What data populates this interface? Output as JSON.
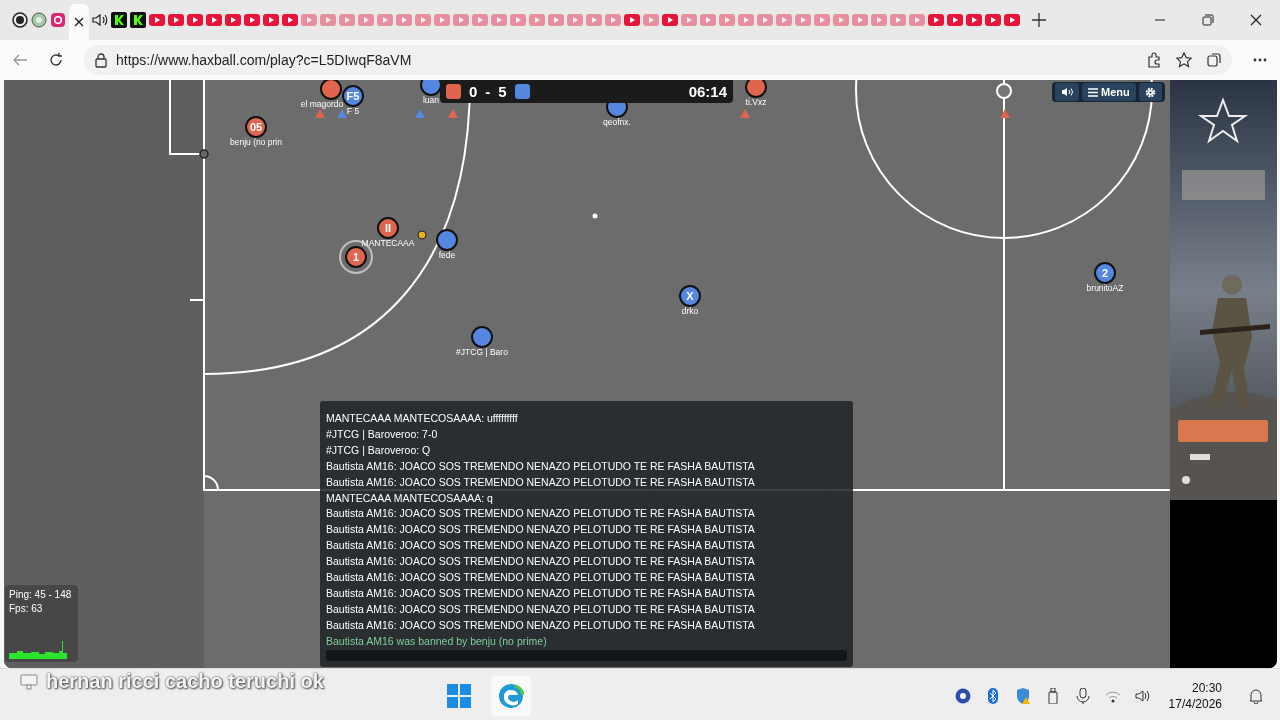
{
  "browser": {
    "tabs": [
      {
        "kind": "record",
        "sleeping": false,
        "selected": false
      },
      {
        "kind": "ball",
        "sleeping": false,
        "selected": false
      },
      {
        "kind": "instagram",
        "sleeping": false,
        "selected": false
      },
      {
        "kind": "close",
        "sleeping": false,
        "selected": true
      },
      {
        "kind": "audio",
        "sleeping": false,
        "selected": false
      },
      {
        "kind": "kick",
        "sleeping": false,
        "selected": false
      },
      {
        "kind": "kick",
        "sleeping": false,
        "selected": false
      },
      {
        "kind": "video",
        "sleeping": false,
        "selected": false
      },
      {
        "kind": "video",
        "sleeping": false,
        "selected": false
      },
      {
        "kind": "video",
        "sleeping": false,
        "selected": false
      },
      {
        "kind": "video",
        "sleeping": false,
        "selected": false
      },
      {
        "kind": "video",
        "sleeping": false,
        "selected": false
      },
      {
        "kind": "video",
        "sleeping": false,
        "selected": false
      },
      {
        "kind": "video",
        "sleeping": false,
        "selected": false
      },
      {
        "kind": "video",
        "sleeping": false,
        "selected": false
      },
      {
        "kind": "video",
        "sleeping": true,
        "selected": false
      },
      {
        "kind": "video",
        "sleeping": true,
        "selected": false
      },
      {
        "kind": "video",
        "sleeping": true,
        "selected": false
      },
      {
        "kind": "video",
        "sleeping": true,
        "selected": false
      },
      {
        "kind": "video",
        "sleeping": true,
        "selected": false
      },
      {
        "kind": "video",
        "sleeping": true,
        "selected": false
      },
      {
        "kind": "video",
        "sleeping": true,
        "selected": false
      },
      {
        "kind": "video",
        "sleeping": true,
        "selected": false
      },
      {
        "kind": "video",
        "sleeping": true,
        "selected": false
      },
      {
        "kind": "video",
        "sleeping": true,
        "selected": false
      },
      {
        "kind": "video",
        "sleeping": true,
        "selected": false
      },
      {
        "kind": "video",
        "sleeping": true,
        "selected": false
      },
      {
        "kind": "video",
        "sleeping": true,
        "selected": false
      },
      {
        "kind": "video",
        "sleeping": true,
        "selected": false
      },
      {
        "kind": "video",
        "sleeping": true,
        "selected": false
      },
      {
        "kind": "video",
        "sleeping": true,
        "selected": false
      },
      {
        "kind": "video",
        "sleeping": true,
        "selected": false
      },
      {
        "kind": "video",
        "sleeping": false,
        "selected": false
      },
      {
        "kind": "video",
        "sleeping": true,
        "selected": false
      },
      {
        "kind": "video",
        "sleeping": false,
        "selected": false
      },
      {
        "kind": "video",
        "sleeping": true,
        "selected": false
      },
      {
        "kind": "video",
        "sleeping": true,
        "selected": false
      },
      {
        "kind": "video",
        "sleeping": true,
        "selected": false
      },
      {
        "kind": "video",
        "sleeping": true,
        "selected": false
      },
      {
        "kind": "video",
        "sleeping": true,
        "selected": false
      },
      {
        "kind": "video",
        "sleeping": true,
        "selected": false
      },
      {
        "kind": "video",
        "sleeping": true,
        "selected": false
      },
      {
        "kind": "video",
        "sleeping": true,
        "selected": false
      },
      {
        "kind": "video",
        "sleeping": true,
        "selected": false
      },
      {
        "kind": "video",
        "sleeping": true,
        "selected": false
      },
      {
        "kind": "video",
        "sleeping": true,
        "selected": false
      },
      {
        "kind": "video",
        "sleeping": true,
        "selected": false
      },
      {
        "kind": "video",
        "sleeping": true,
        "selected": false
      },
      {
        "kind": "video",
        "sleeping": false,
        "selected": false
      },
      {
        "kind": "video",
        "sleeping": false,
        "selected": false
      },
      {
        "kind": "video",
        "sleeping": false,
        "selected": false
      },
      {
        "kind": "video",
        "sleeping": false,
        "selected": false
      },
      {
        "kind": "video",
        "sleeping": false,
        "selected": false
      }
    ],
    "url": "https://www.haxball.com/play?c=L5DIwqF8aVM"
  },
  "game": {
    "scoreboard": {
      "red_score": "0",
      "separator": "-",
      "blue_score": "5",
      "time": "06:14"
    },
    "menu_button": "Menu",
    "players": [
      {
        "name": "el magordo",
        "color": "#e0654f",
        "highlighted": false
      },
      {
        "name": "F 5",
        "label": "F5",
        "color": "#5586e0",
        "highlighted": false
      },
      {
        "name": "luan",
        "color": "#5586e0",
        "highlighted": false
      },
      {
        "name": "qeofnx.",
        "color": "#5586e0",
        "highlighted": false
      },
      {
        "name": "ti.Vxz",
        "color": "#e0654f",
        "highlighted": false
      },
      {
        "name": "benju (no prin",
        "label": "05",
        "color": "#e0654f",
        "highlighted": false
      },
      {
        "name": "MANTECAAA",
        "label": "II",
        "color": "#e0654f",
        "highlighted": false
      },
      {
        "label": "1",
        "color": "#e0654f",
        "highlighted": true
      },
      {
        "name": "fede",
        "color": "#5586e0",
        "highlighted": false
      },
      {
        "name": "drko",
        "label": "X",
        "color": "#5586e0",
        "highlighted": false
      },
      {
        "name": "#JTCG | Baro",
        "color": "#5586e0",
        "highlighted": false
      },
      {
        "name": "brunitoAZ",
        "label": "2",
        "color": "#5586e0",
        "highlighted": false
      }
    ],
    "offscreen_markers": [
      {
        "color": "#e0654f"
      },
      {
        "color": "#5586e0"
      },
      {
        "color": "#5586e0"
      },
      {
        "color": "#e0654f"
      },
      {
        "color": "#e0654f"
      },
      {
        "color": "#e0654f"
      }
    ],
    "chat": [
      {
        "kind": "message",
        "text": "MANTECAAA MANTECOSAAAA: ufffffffff"
      },
      {
        "kind": "message",
        "text": "#JTCG | Baroveroo: 7-0"
      },
      {
        "kind": "message",
        "text": "#JTCG | Baroveroo: Q"
      },
      {
        "kind": "message",
        "text": "Bautista AM16: JOACO SOS TREMENDO NENAZO PELOTUDO TE RE FASHA BAUTISTA"
      },
      {
        "kind": "message",
        "text": "Bautista AM16: JOACO SOS TREMENDO NENAZO PELOTUDO TE RE FASHA BAUTISTA"
      },
      {
        "kind": "message",
        "text": "MANTECAAA MANTECOSAAAA: q"
      },
      {
        "kind": "message",
        "text": "Bautista AM16: JOACO SOS TREMENDO NENAZO PELOTUDO TE RE FASHA BAUTISTA"
      },
      {
        "kind": "message",
        "text": "Bautista AM16: JOACO SOS TREMENDO NENAZO PELOTUDO TE RE FASHA BAUTISTA"
      },
      {
        "kind": "message",
        "text": "Bautista AM16: JOACO SOS TREMENDO NENAZO PELOTUDO TE RE FASHA BAUTISTA"
      },
      {
        "kind": "message",
        "text": "Bautista AM16: JOACO SOS TREMENDO NENAZO PELOTUDO TE RE FASHA BAUTISTA"
      },
      {
        "kind": "message",
        "text": "Bautista AM16: JOACO SOS TREMENDO NENAZO PELOTUDO TE RE FASHA BAUTISTA"
      },
      {
        "kind": "message",
        "text": "Bautista AM16: JOACO SOS TREMENDO NENAZO PELOTUDO TE RE FASHA BAUTISTA"
      },
      {
        "kind": "message",
        "text": "Bautista AM16: JOACO SOS TREMENDO NENAZO PELOTUDO TE RE FASHA BAUTISTA"
      },
      {
        "kind": "message",
        "text": "Bautista AM16: JOACO SOS TREMENDO NENAZO PELOTUDO TE RE FASHA BAUTISTA"
      },
      {
        "kind": "notice",
        "text": "Bautista AM16 was banned by benju (no prime)"
      }
    ],
    "stats": {
      "ping": "Ping: 45 - 148",
      "fps": "Fps: 63"
    }
  },
  "caption": "hernan ricci cacho teruchi ok",
  "taskbar": {
    "time": "20:30",
    "date": "17/4/2026"
  }
}
